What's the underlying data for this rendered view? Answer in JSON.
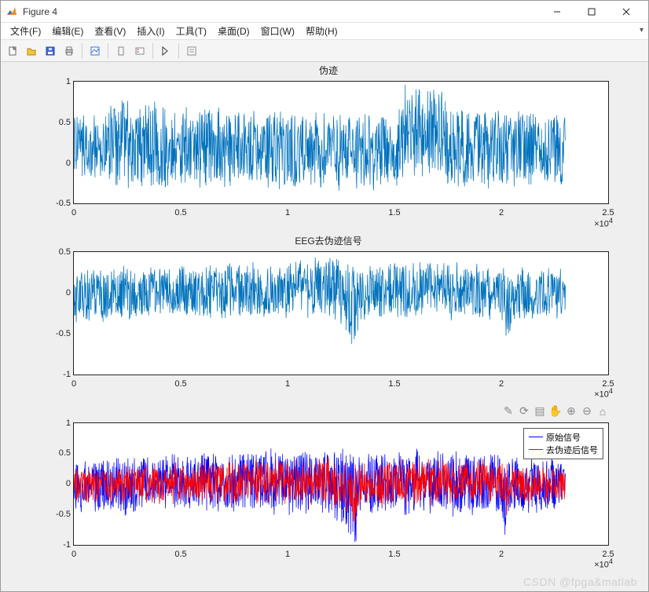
{
  "window": {
    "title": "Figure 4",
    "controls": {
      "min": "minimize",
      "max": "maximize",
      "close": "close"
    }
  },
  "menus": {
    "file": {
      "label": "文件(F)"
    },
    "edit": {
      "label": "编辑(E)"
    },
    "view": {
      "label": "查看(V)"
    },
    "insert": {
      "label": "插入(I)"
    },
    "tools": {
      "label": "工具(T)"
    },
    "desktop": {
      "label": "桌面(D)"
    },
    "window": {
      "label": "窗口(W)"
    },
    "help": {
      "label": "帮助(H)"
    }
  },
  "toolbar_icons": [
    "new-file",
    "open",
    "save",
    "print",
    "linked-plot",
    "draw-rect",
    "draw-colorbox",
    "cursor",
    "data-tips"
  ],
  "axes_toolbar_icons": [
    "brush",
    "rotate",
    "data-cursor",
    "pan",
    "zoom-in",
    "zoom-out",
    "home"
  ],
  "watermark": "CSDN @fpga&matlab",
  "colors": {
    "series_blue": "#0072BD",
    "raw_blue": "#0000FF",
    "clean_red": "#FF0000"
  },
  "legend": {
    "raw": "原始信号",
    "clean": "去伪迹后信号"
  },
  "subplots": [
    {
      "title": "伪迹",
      "ylim": [
        -0.5,
        1
      ],
      "yticks": [
        -0.5,
        0,
        0.5,
        1
      ],
      "xlim": [
        0,
        2.5
      ],
      "xticks": [
        0,
        0.5,
        1,
        1.5,
        2,
        2.5
      ],
      "xexp": "×10",
      "xexp_pow": "4"
    },
    {
      "title": "EEG去伪迹信号",
      "ylim": [
        -1,
        0.5
      ],
      "yticks": [
        -1,
        -0.5,
        0,
        0.5
      ],
      "xlim": [
        0,
        2.5
      ],
      "xticks": [
        0,
        0.5,
        1,
        1.5,
        2,
        2.5
      ],
      "xexp": "×10",
      "xexp_pow": "4"
    },
    {
      "title": "",
      "ylim": [
        -1,
        1
      ],
      "yticks": [
        -1,
        -0.5,
        0,
        0.5,
        1
      ],
      "xlim": [
        0,
        2.5
      ],
      "xticks": [
        0,
        0.5,
        1,
        1.5,
        2,
        2.5
      ],
      "xexp": "×10",
      "xexp_pow": "4"
    }
  ],
  "chart_data": [
    {
      "type": "line",
      "title": "伪迹",
      "xlabel": "",
      "ylabel": "",
      "xlim": [
        0,
        25000
      ],
      "ylim": [
        -0.5,
        1
      ],
      "note": "Dense noisy artifact signal, ~23000 samples. Mean ≈0.25, range roughly [-0.5,0.9] with an elevated burst around x≈15500–17000 (values up to ~0.95).",
      "series": [
        {
          "name": "artifact",
          "color": "#0072BD",
          "envelope_x": [
            0,
            1500,
            2000,
            5000,
            7000,
            10000,
            13000,
            15000,
            15500,
            17000,
            17500,
            20000,
            23000
          ],
          "envelope_upper": [
            0.55,
            0.55,
            0.8,
            0.62,
            0.68,
            0.6,
            0.58,
            0.6,
            0.95,
            0.95,
            0.65,
            0.62,
            0.58
          ],
          "envelope_lower": [
            -0.1,
            -0.25,
            -0.3,
            -0.3,
            -0.25,
            -0.3,
            -0.3,
            -0.3,
            -0.12,
            -0.12,
            -0.28,
            -0.28,
            -0.3
          ],
          "baseline": 0.25
        }
      ]
    },
    {
      "type": "line",
      "title": "EEG去伪迹信号",
      "xlabel": "",
      "ylabel": "",
      "xlim": [
        0,
        25000
      ],
      "ylim": [
        -1,
        0.5
      ],
      "note": "EEG after artifact removal, centered near 0, range roughly [-0.7,0.45], with sharp negative spikes near x≈13200 (~-0.72) and x≈20300 (~-0.65).",
      "series": [
        {
          "name": "eeg_clean",
          "color": "#0072BD",
          "envelope_x": [
            0,
            3000,
            6000,
            9000,
            12000,
            13200,
            13400,
            16000,
            20000,
            20300,
            20500,
            23000
          ],
          "envelope_upper": [
            0.25,
            0.3,
            0.32,
            0.35,
            0.4,
            0.3,
            0.3,
            0.35,
            0.32,
            0.3,
            0.3,
            0.28
          ],
          "envelope_lower": [
            -0.35,
            -0.3,
            -0.28,
            -0.3,
            -0.3,
            -0.72,
            -0.3,
            -0.3,
            -0.3,
            -0.65,
            -0.3,
            -0.28
          ],
          "baseline": 0.0
        }
      ]
    },
    {
      "type": "line",
      "title": "",
      "xlabel": "",
      "ylabel": "",
      "xlim": [
        0,
        25000
      ],
      "ylim": [
        -1,
        1
      ],
      "note": "Overlay of raw EEG (blue) vs artifact-removed EEG (red). Blue has larger swings (~[-1,0.7]); red tracks it with ~[-0.6,0.5]. Deep blue dips near x≈13200 and x≈20300 to ~-1.0.",
      "legend_position": "northeast",
      "series": [
        {
          "name": "原始信号",
          "color": "#0000FF",
          "envelope_x": [
            0,
            3000,
            6000,
            9000,
            12000,
            13200,
            13400,
            16000,
            20000,
            20300,
            20500,
            23000
          ],
          "envelope_upper": [
            0.35,
            0.45,
            0.5,
            0.55,
            0.55,
            0.45,
            0.45,
            0.55,
            0.5,
            0.45,
            0.45,
            0.4
          ],
          "envelope_lower": [
            -0.45,
            -0.45,
            -0.4,
            -0.45,
            -0.45,
            -1.0,
            -0.45,
            -0.5,
            -0.45,
            -1.0,
            -0.45,
            -0.4
          ],
          "baseline": 0.0
        },
        {
          "name": "去伪迹后信号",
          "color": "#FF0000",
          "envelope_x": [
            0,
            3000,
            6000,
            9000,
            12000,
            13200,
            13400,
            16000,
            20000,
            20300,
            20500,
            23000
          ],
          "envelope_upper": [
            0.25,
            0.3,
            0.35,
            0.38,
            0.4,
            0.3,
            0.3,
            0.4,
            0.35,
            0.3,
            0.3,
            0.28
          ],
          "envelope_lower": [
            -0.3,
            -0.3,
            -0.28,
            -0.3,
            -0.3,
            -0.6,
            -0.3,
            -0.35,
            -0.3,
            -0.6,
            -0.3,
            -0.28
          ],
          "baseline": 0.0
        }
      ]
    }
  ]
}
